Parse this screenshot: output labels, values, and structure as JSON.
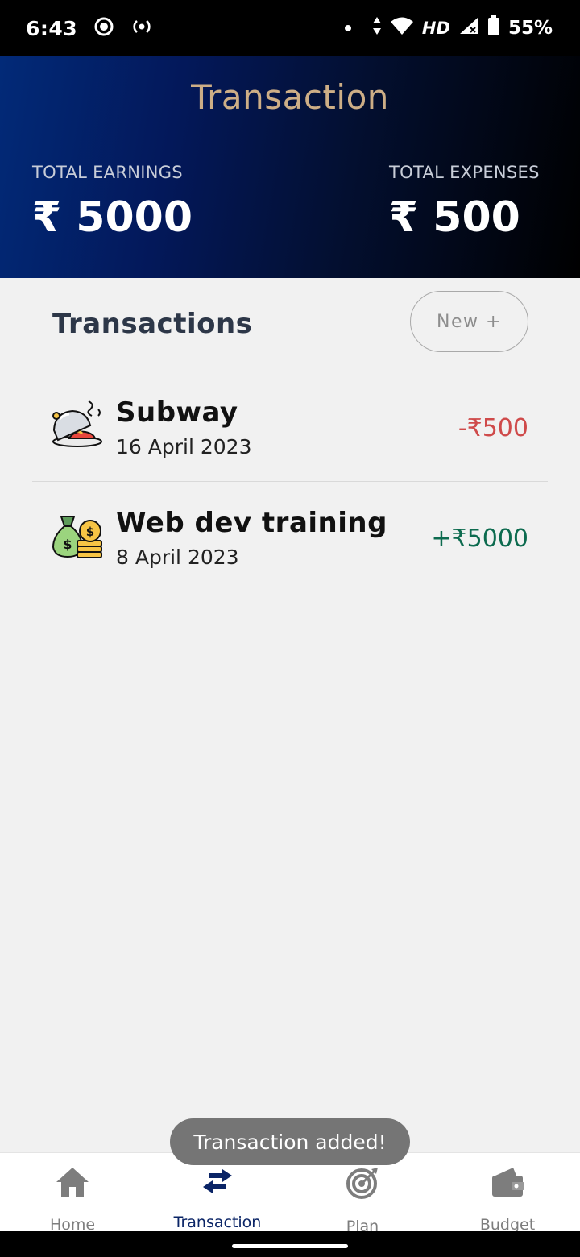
{
  "status_bar": {
    "time": "6:43",
    "network": "HD",
    "battery": "55%",
    "icons": [
      "record-icon",
      "hotspot-icon",
      "notification-dot-icon",
      "data-arrows-icon",
      "wifi-icon",
      "signal-icon",
      "battery-icon"
    ]
  },
  "header": {
    "title": "Transaction",
    "earnings_label": "TOTAL EARNINGS",
    "earnings_value": "₹ 5000",
    "expenses_label": "TOTAL EXPENSES",
    "expenses_value": "₹ 500"
  },
  "section": {
    "title": "Transactions",
    "new_button": "New +"
  },
  "transactions": [
    {
      "name": "Subway",
      "date": "16 April 2023",
      "amount": "-₹500",
      "type": "expense",
      "icon": "food-cloche-icon"
    },
    {
      "name": "Web dev training",
      "date": "8 April 2023",
      "amount": "+₹5000",
      "type": "income",
      "icon": "money-bag-icon"
    }
  ],
  "toast": "Transaction added!",
  "nav": [
    {
      "label": "Home",
      "icon": "home-icon",
      "active": false
    },
    {
      "label": "Transaction",
      "icon": "transfer-arrows-icon",
      "active": true
    },
    {
      "label": "Plan",
      "icon": "target-icon",
      "active": false
    },
    {
      "label": "Budget",
      "icon": "wallet-icon",
      "active": false
    }
  ],
  "colors": {
    "header_gradient_start": "#022a78",
    "header_gradient_end": "#000000",
    "title_gold": "#cdae86",
    "expense_red": "#cf4a4a",
    "income_green": "#0d6b4f",
    "nav_active": "#0a2466"
  }
}
